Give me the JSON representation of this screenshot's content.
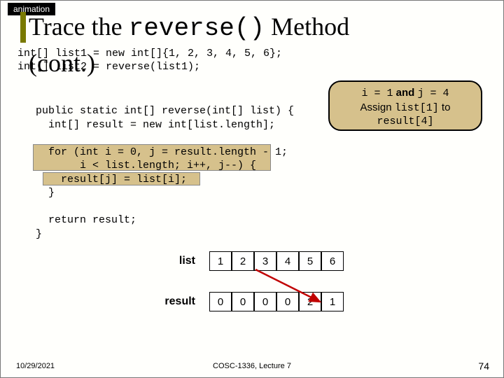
{
  "tag": "animation",
  "title_pre": "Trace the ",
  "title_mono": "reverse()",
  "title_post": " Method",
  "cont": "(cont.)",
  "top_code": "int[] list1 = new int[]{1, 2, 3, 4, 5, 6};\nint[] list2 = reverse(list1);",
  "method_code": "public static int[] reverse(int[] list) {\n  int[] result = new int[list.length];\n\n  for (int i = 0, j = result.length - 1;\n       i < list.length; i++, j--) {\n    result[j] = list[i];\n  }\n\n  return result;\n}",
  "callout": {
    "l1a": "i = 1",
    "l1b": " and ",
    "l1c": "j = 4",
    "l2a": "Assign ",
    "l2b": "list[1]",
    "l2c": " to",
    "l3": "result[4]"
  },
  "arrays": {
    "list_label": "list",
    "result_label": "result",
    "list": [
      "1",
      "2",
      "3",
      "4",
      "5",
      "6"
    ],
    "result": [
      "0",
      "0",
      "0",
      "0",
      "2",
      "1"
    ]
  },
  "footer": {
    "date": "10/29/2021",
    "center": "COSC-1336, Lecture 7",
    "page": "74"
  }
}
